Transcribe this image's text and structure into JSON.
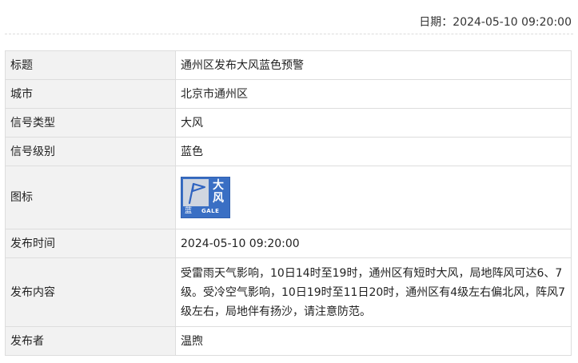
{
  "header": {
    "date_label": "日期：",
    "date_value": "2024-05-10 09:20:00"
  },
  "rows": [
    {
      "label": "标题",
      "value": "通州区发布大风蓝色预警"
    },
    {
      "label": "城市",
      "value": "北京市通州区"
    },
    {
      "label": "信号类型",
      "value": "大风"
    },
    {
      "label": "信号级别",
      "value": "蓝色"
    },
    {
      "label": "图标",
      "value": ""
    },
    {
      "label": "发布时间",
      "value": "2024-05-10 09:20:00"
    },
    {
      "label": "发布内容",
      "value": "受雷雨天气影响，10日14时至19时，通州区有短时大风，局地阵风可达6、7级。受冷空气影响，10日19时至11日20时，通州区有4级左右偏北风，阵风7级左右，局地伴有扬沙，请注意防范。"
    },
    {
      "label": "发布者",
      "value": "温煦"
    }
  ],
  "warning_icon": {
    "char_1": "大",
    "char_2": "风",
    "level_char": "蓝",
    "code": "GALE",
    "icon_name": "gale-blue-warning-icon",
    "color": "#3a6fc4"
  }
}
